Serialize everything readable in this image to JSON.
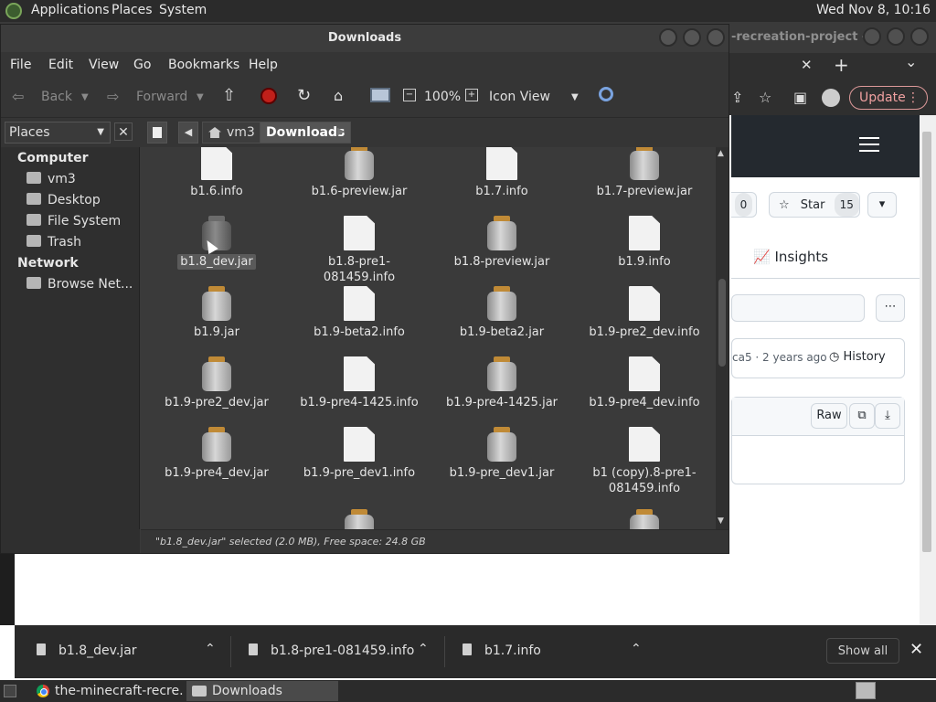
{
  "top_panel": {
    "menus": [
      "Applications",
      "Places",
      "System"
    ],
    "clock": "Wed Nov 8, 10:16"
  },
  "browser": {
    "tab_title": "-recreation-project -...",
    "new_tab": "+",
    "close_tab": "✕",
    "tab_menu": "⌄",
    "update_label": "Update",
    "watch_count": "0",
    "star_label": "Star",
    "star_count": "15",
    "insights": "Insights",
    "commit_meta": "ca5 · 2 years ago",
    "history": "History",
    "raw": "Raw"
  },
  "downloads_bar": {
    "items": [
      "b1.8_dev.jar",
      "b1.8-pre1-081459.info",
      "b1.7.info"
    ],
    "show_all": "Show all",
    "close": "✕"
  },
  "taskbar": {
    "tasks": [
      "the-minecraft-recre...",
      "Downloads"
    ]
  },
  "file_manager": {
    "title": "Downloads",
    "menus": [
      "File",
      "Edit",
      "View",
      "Go",
      "Bookmarks",
      "Help"
    ],
    "toolbar": {
      "back": "Back",
      "forward": "Forward",
      "zoom": "100%",
      "view_mode": "Icon View"
    },
    "places_label": "Places",
    "breadcrumbs": [
      "vm3",
      "Downloads"
    ],
    "sidebar": {
      "computer_header": "Computer",
      "computer_items": [
        "vm3",
        "Desktop",
        "File System",
        "Trash"
      ],
      "network_header": "Network",
      "network_items": [
        "Browse Net..."
      ]
    },
    "files": [
      {
        "name": "b1.6.info",
        "type": "doc"
      },
      {
        "name": "b1.6-preview.jar",
        "type": "jar"
      },
      {
        "name": "b1.7.info",
        "type": "doc"
      },
      {
        "name": "b1.7-preview.jar",
        "type": "jar"
      },
      {
        "name": "b1.8_dev.jar",
        "type": "jar",
        "selected": true
      },
      {
        "name": "b1.8-pre1-081459.info",
        "type": "doc"
      },
      {
        "name": "b1.8-preview.jar",
        "type": "jar"
      },
      {
        "name": "b1.9.info",
        "type": "doc"
      },
      {
        "name": "b1.9.jar",
        "type": "jar"
      },
      {
        "name": "b1.9-beta2.info",
        "type": "doc"
      },
      {
        "name": "b1.9-beta2.jar",
        "type": "jar"
      },
      {
        "name": "b1.9-pre2_dev.info",
        "type": "doc"
      },
      {
        "name": "b1.9-pre2_dev.jar",
        "type": "jar"
      },
      {
        "name": "b1.9-pre4-1425.info",
        "type": "doc"
      },
      {
        "name": "b1.9-pre4-1425.jar",
        "type": "jar"
      },
      {
        "name": "b1.9-pre4_dev.info",
        "type": "doc"
      },
      {
        "name": "b1.9-pre4_dev.jar",
        "type": "jar"
      },
      {
        "name": "b1.9-pre_dev1.info",
        "type": "doc"
      },
      {
        "name": "b1.9-pre_dev1.jar",
        "type": "jar"
      },
      {
        "name": "b1 (copy).8-pre1-081459.info",
        "type": "doc"
      }
    ],
    "partial_row_types": [
      "doc",
      "jar",
      "doc",
      "jar"
    ],
    "status": "\"b1.8_dev.jar\" selected (2.0 MB), Free space: 24.8 GB"
  }
}
